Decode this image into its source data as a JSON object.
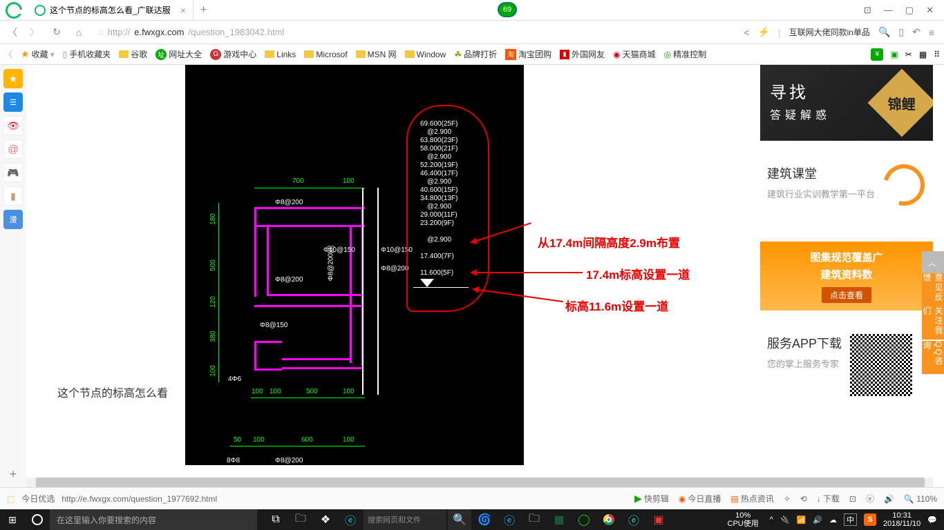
{
  "titlebar": {
    "tab_title": "这个节点的标高怎么看_广联达服",
    "badge": "69"
  },
  "addr": {
    "url_prefix": "http://",
    "url_host": "e.fwxgx.com",
    "url_path": "/question_1983042.html",
    "promo": "互联网大佬同款in单品"
  },
  "bookmarks": {
    "fav": "收藏",
    "phonefav": "手机收藏夹",
    "google": "谷歌",
    "sites": "网址大全",
    "game": "游戏中心",
    "links": "Links",
    "ms": "Microsof",
    "msn": "MSN 网",
    "window": "Window",
    "brand": "品牌打折",
    "taobao": "淘宝团购",
    "foreign": "外国网友",
    "tmall": "天猫商城",
    "precise": "精准控制"
  },
  "page": {
    "caption": "这个节点的标高怎么看",
    "anno1": "从17.4m间隔高度2.9m布置",
    "anno2": "17.4m标高设置一道",
    "anno3": "标高11.6m设置一道",
    "cad": {
      "d700": "700",
      "d100a": "100",
      "d100b": "100",
      "d100c": "100",
      "d500": "500",
      "d500v": "500",
      "d180": "180",
      "d120": "120",
      "d380": "380",
      "d100v": "100",
      "d50": "50",
      "d100d": "100",
      "d600": "600",
      "d100e": "100",
      "r88200": "Φ8@200",
      "r88200b": "Φ8@200",
      "r10150": "Φ10@150",
      "r88150": "Φ8@150",
      "r882008": "Φ8@200[8]",
      "r446": "4Φ6",
      "r10150b": "Φ10@150",
      "r88200c": "Φ8@200",
      "lvl": {
        "a": "69.600(25F)",
        "b": "@2.900",
        "c": "63.800(23F)",
        "d": "58.000(21F)",
        "e": "@2.900",
        "f": "52.200(19F)",
        "g": "46.400(17F)",
        "h": "@2.900",
        "i": "40.600(15F)",
        "j": "34.800(13F)",
        "k": "@2.900",
        "l": "29.000(11F)",
        "m": "23.200(9F)",
        "n": "@2.900",
        "o": "17.400(7F)",
        "p": "11.600(5F)"
      }
    }
  },
  "rside": {
    "b1": {
      "t1": "寻找",
      "t2": "答疑解惑",
      "stamp": "锦鲤"
    },
    "c2": {
      "h": "建筑课堂",
      "s": "建筑行业实训教学第一平台"
    },
    "b3": {
      "l1": "图集规范覆盖广",
      "l2": "建筑资料数",
      "btn": "点击查看"
    },
    "c4": {
      "h": "服务APP下载",
      "s": "您的掌上服务专家"
    },
    "float": {
      "top": "︿",
      "op": "意见反馈",
      "att": "关注我们",
      "qq": "QQ咨询"
    }
  },
  "status": {
    "today": "今日优选",
    "url": "http://e.fwxgx.com/question_1977692.html",
    "clip": "快剪辑",
    "live": "今日直播",
    "hot": "热点资讯",
    "dl": "下载",
    "zoom": "110%"
  },
  "taskbar": {
    "search_ph": "在这里输入你要搜索的内容",
    "search2_ph": "搜索网页和文件",
    "cpu_pct": "10%",
    "cpu_lbl": "CPU使用",
    "ime": "中",
    "time": "10:31",
    "date": "2018/11/10"
  }
}
